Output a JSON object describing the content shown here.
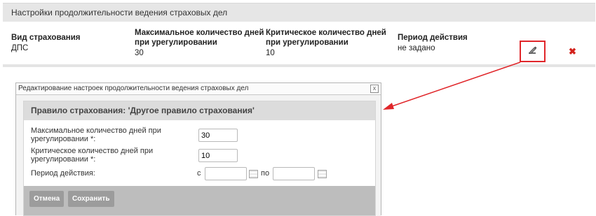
{
  "settings": {
    "title": "Настройки продолжительности ведения страховых дел",
    "columns": [
      {
        "header_line1": "Вид страхования",
        "header_line2": "",
        "value": "ДПС"
      },
      {
        "header_line1": "Максимальное количество дней",
        "header_line2": "при урегулировании",
        "value": "30"
      },
      {
        "header_line1": "Критическое количество дней",
        "header_line2": "при урегулировании",
        "value": "10"
      },
      {
        "header_line1": "Период действия",
        "header_line2": "",
        "value": "не задано"
      }
    ],
    "edit_icon": "pencil-icon",
    "delete_icon": "red-x-icon",
    "delete_glyph": "✖",
    "highlight_color": "#e0262a"
  },
  "dialog": {
    "title": "Редактирование настроек продолжительности ведения страховых дел",
    "close_glyph": "x",
    "rule_title": "Правило страхования: 'Другое правило страхования'",
    "max_days_label_line1": "Максимальное количество дней при",
    "max_days_label_line2": "урегулировании *:",
    "max_days_value": "30",
    "crit_days_label_line1": "Критическое количество дней при",
    "crit_days_label_line2": "урегулировании *:",
    "crit_days_value": "10",
    "period_label": "Период действия:",
    "from_label": "с",
    "to_label": "по",
    "from_value": "",
    "to_value": "",
    "cancel_label": "Отмена",
    "save_label": "Сохранить"
  }
}
